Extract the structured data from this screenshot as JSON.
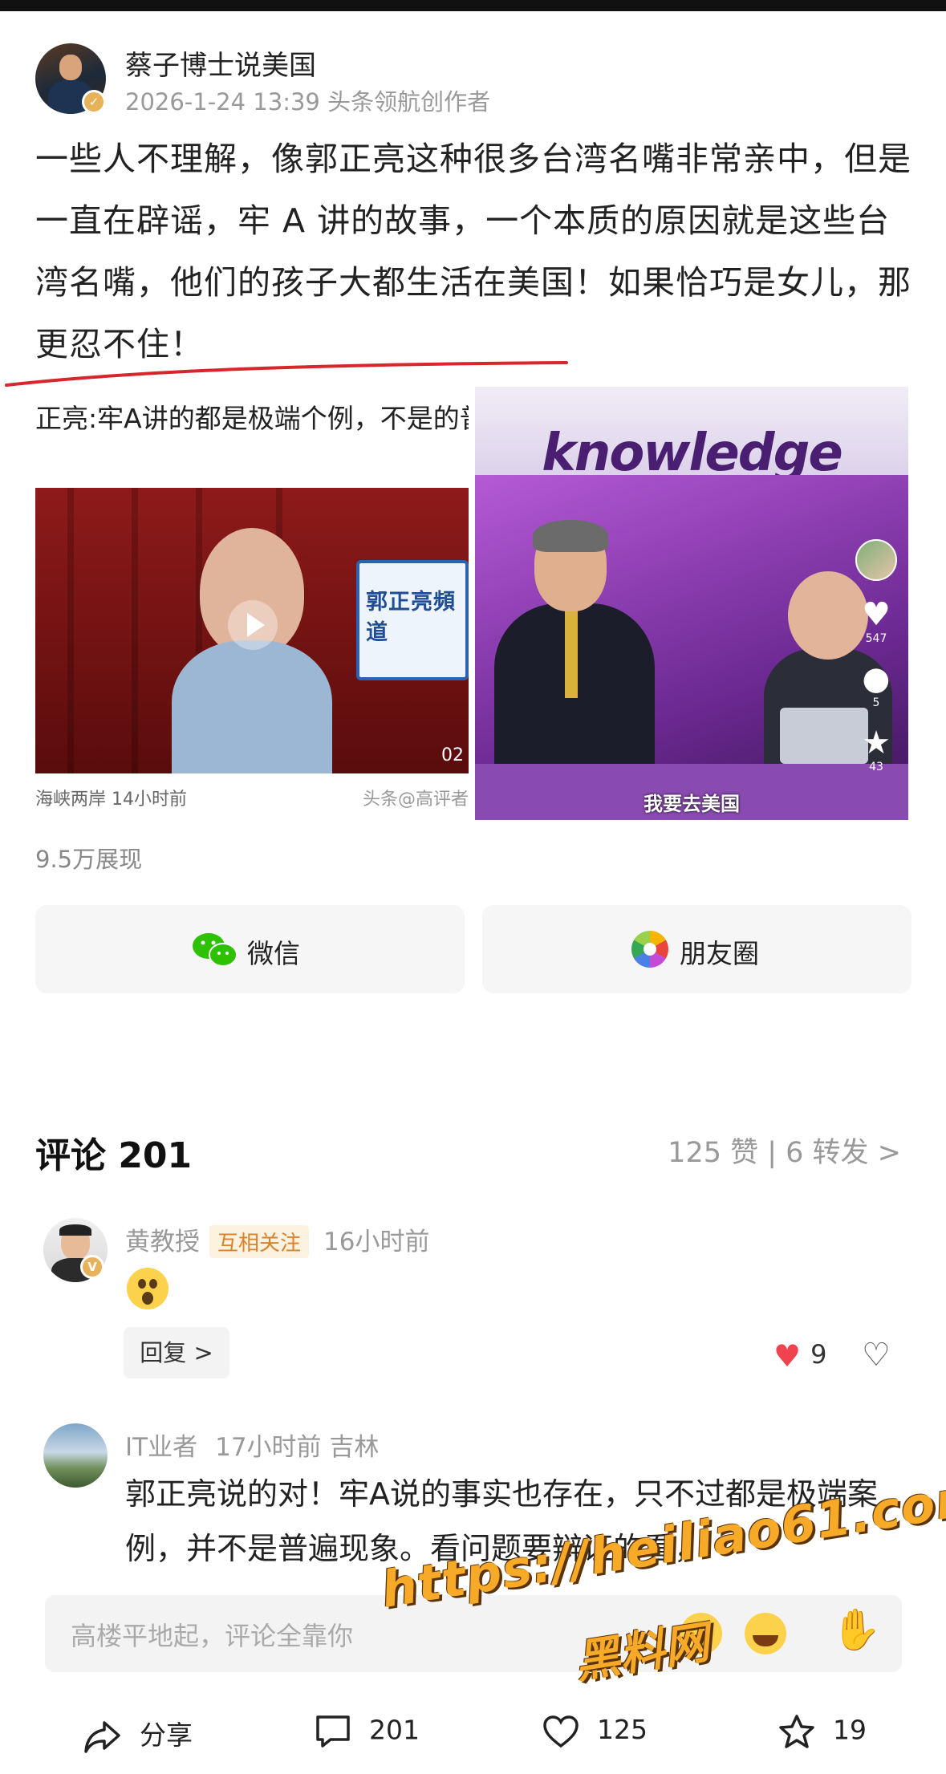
{
  "post": {
    "author": "蔡子博士说美国",
    "meta": "2026-1-24 13:39  头条领航创作者",
    "text": "一些人不理解，像郭正亮这种很多台湾名嘴非常亲中，但是一直在辟谣，牢 A 讲的故事，一个本质的原因就是这些台湾名嘴，他们的孩子大都生活在美国！如果恰巧是女儿，那更忍不住！",
    "views": "9.5万展现"
  },
  "media_left": {
    "caption": "正亮:牢A讲的都是极端个例，不是的普遍性，太夸张了！",
    "sign_text": "郭正亮頻道",
    "time": "02",
    "footer": "海峡两岸  14小时前",
    "footer_right": "头条@高评者"
  },
  "media_right": {
    "banner": "knowledge",
    "subtitle": "我要去美国",
    "likes": "547",
    "comments": "5",
    "stars": "43"
  },
  "share": {
    "wechat_label": "微信",
    "moments_label": "朋友圈"
  },
  "comments": {
    "title": "评论 201",
    "stats": "125 赞 | 6 转发 >",
    "items": [
      {
        "name": "黄教授",
        "badge": "互相关注",
        "time": "16小时前",
        "reply": "回复 >",
        "likes": "9"
      },
      {
        "name": "IT业者",
        "meta": "17小时前  吉林",
        "text": "郭正亮说的对！牢A说的事实也存在，只不过都是极端案例，并不是普遍现象。看问题要辩证的看，"
      }
    ]
  },
  "input": {
    "placeholder": "高楼平地起，评论全靠你"
  },
  "bottom": {
    "share": "分享",
    "comments": "201",
    "likes": "125",
    "favorites": "19"
  },
  "watermark": {
    "url": "https://heiliao61.com",
    "name": "黑料网"
  },
  "colors": {
    "accent_red": "#f0434f",
    "badge_orange": "#d9822b",
    "watermark": "#f7a928"
  }
}
